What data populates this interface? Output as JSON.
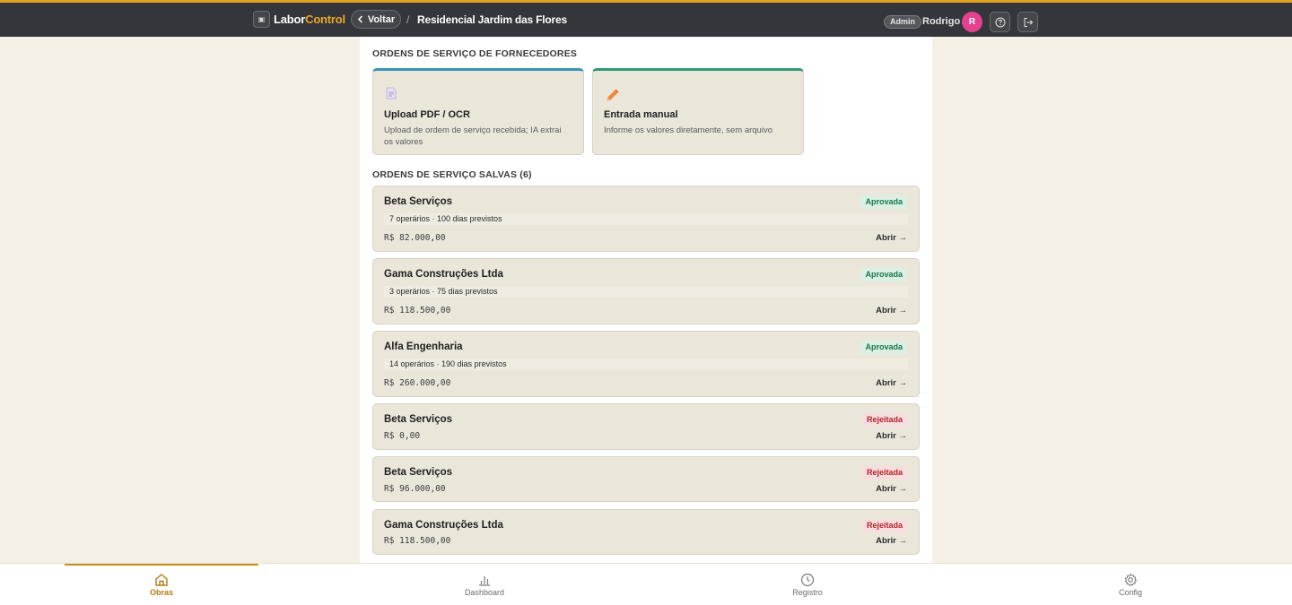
{
  "header": {
    "brand_part1": "Labor",
    "brand_part2": "Control",
    "back_label": "Voltar",
    "separator": "/",
    "title": "Residencial Jardim das Flores",
    "role_badge": "Admin",
    "user_name": "Rodrigo",
    "avatar_initial": "R",
    "accent_color": "#e0a21d",
    "avatar_color": "#e4418f"
  },
  "supplier_orders": {
    "heading": "ORDENS DE SERVIÇO DE FORNECEDORES",
    "options": [
      {
        "icon": "document-icon",
        "title": "Upload PDF / OCR",
        "desc_line1": "Upload de ordem de serviço recebida; IA extrai",
        "desc_line2": "os valores",
        "accent": "#3b93b8"
      },
      {
        "icon": "pencil-icon",
        "title": "Entrada manual",
        "desc_line1": "Informe os valores diretamente, sem arquivo",
        "desc_line2": "",
        "accent": "#2f9a72"
      }
    ]
  },
  "saved_orders": {
    "heading": "ORDENS DE SERVIÇO SALVAS (6)",
    "open_label": "Abrir →",
    "items": [
      {
        "name": "Beta Serviços",
        "status": "Aprovada",
        "meta": "7 operários · 100 dias previstos",
        "value": "R$ 82.000,00"
      },
      {
        "name": "Gama Construções Ltda",
        "status": "Aprovada",
        "meta": "3 operários · 75 dias previstos",
        "value": "R$ 118.500,00"
      },
      {
        "name": "Alfa Engenharia",
        "status": "Aprovada",
        "meta": "14 operários · 190 dias previstos",
        "value": "R$ 260.000,00"
      },
      {
        "name": "Beta Serviços",
        "status": "Rejeitada",
        "meta": "",
        "value": "R$ 0,00"
      },
      {
        "name": "Beta Serviços",
        "status": "Rejeitada",
        "meta": "",
        "value": "R$ 96.000,00"
      },
      {
        "name": "Gama Construções Ltda",
        "status": "Rejeitada",
        "meta": "",
        "value": "R$ 118.500,00"
      }
    ]
  },
  "bottom_nav": {
    "items": [
      {
        "label": "Obras",
        "icon": "home-icon",
        "active": true
      },
      {
        "label": "Dashboard",
        "icon": "bar-chart-icon",
        "active": false
      },
      {
        "label": "Registro",
        "icon": "clock-icon",
        "active": false
      },
      {
        "label": "Config",
        "icon": "gear-icon",
        "active": false
      }
    ]
  }
}
